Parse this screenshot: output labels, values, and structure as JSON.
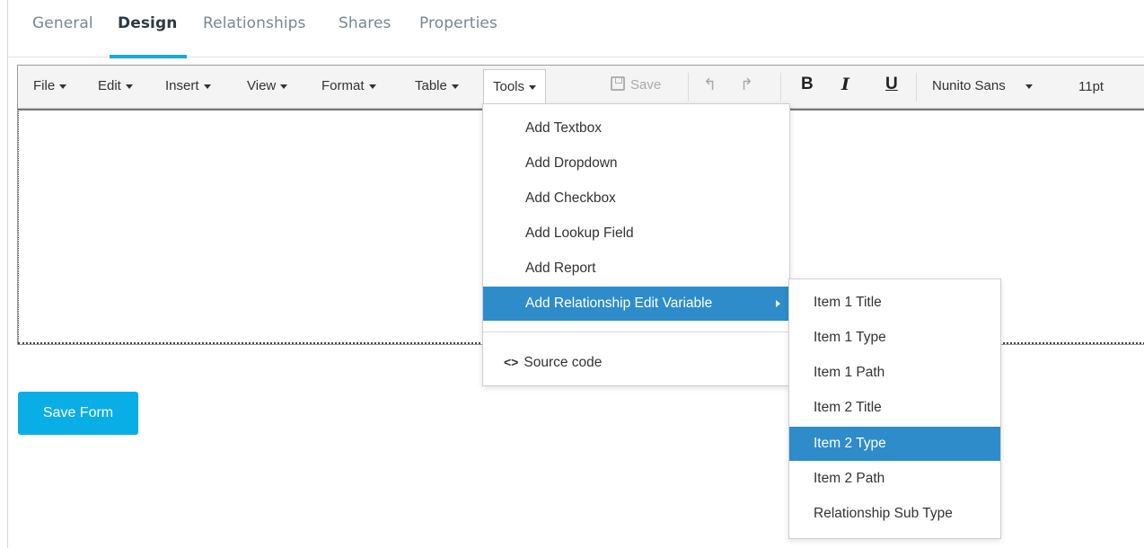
{
  "tabs": [
    {
      "label": "General"
    },
    {
      "label": "Design",
      "active": true
    },
    {
      "label": "Relationships"
    },
    {
      "label": "Shares"
    },
    {
      "label": "Properties"
    }
  ],
  "toolbar": {
    "menus": [
      "File",
      "Edit",
      "Insert",
      "View",
      "Format",
      "Table",
      "Tools"
    ],
    "open_menu": "Tools",
    "save_label": "Save",
    "save_enabled": false,
    "undo_icon": "undo-icon",
    "redo_icon": "redo-icon",
    "bold_label": "B",
    "italic_label": "I",
    "underline_label": "U",
    "font_family": "Nunito Sans",
    "font_size": "11pt"
  },
  "tools_menu": {
    "items": [
      {
        "label": "Add Textbox"
      },
      {
        "label": "Add Dropdown"
      },
      {
        "label": "Add Checkbox"
      },
      {
        "label": "Add Lookup Field"
      },
      {
        "label": "Add Report"
      },
      {
        "label": "Add Relationship Edit Variable",
        "highlighted": true,
        "has_submenu": true
      }
    ],
    "source_code_label": "Source code",
    "source_code_icon": "<>"
  },
  "submenu": {
    "items": [
      {
        "label": "Item 1 Title"
      },
      {
        "label": "Item 1 Type"
      },
      {
        "label": "Item 1 Path"
      },
      {
        "label": "Item 2 Title"
      },
      {
        "label": "Item 2 Type",
        "highlighted": true
      },
      {
        "label": "Item 2 Path"
      },
      {
        "label": "Relationship Sub Type"
      }
    ]
  },
  "save_form_label": "Save Form",
  "colors": {
    "accent": "#17a9e1",
    "highlight": "#2e8ccb",
    "button": "#0aaee6"
  }
}
